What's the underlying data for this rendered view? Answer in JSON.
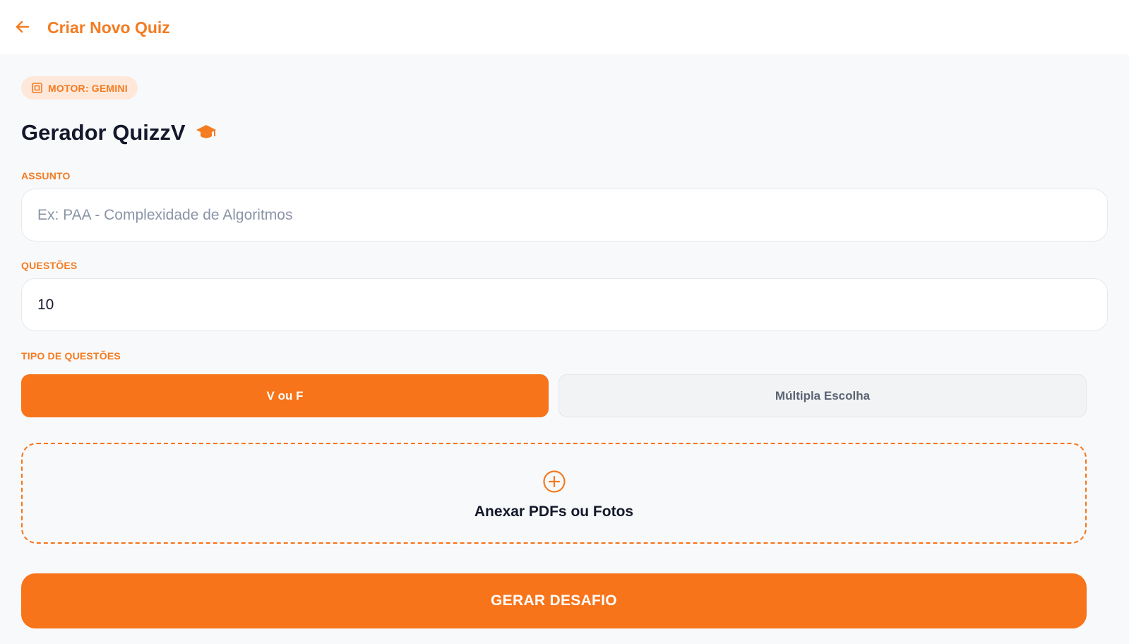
{
  "header": {
    "title": "Criar Novo Quiz",
    "back_icon": "arrow-left-icon"
  },
  "badge": {
    "label": "MOTOR: GEMINI",
    "icon": "chip-icon"
  },
  "heading": {
    "title": "Gerador QuizzV",
    "icon": "graduation-cap-icon"
  },
  "form": {
    "subject": {
      "label": "ASSUNTO",
      "placeholder": "Ex: PAA - Complexidade de Algoritmos",
      "value": ""
    },
    "questions": {
      "label": "QUESTÕES",
      "value": "10"
    },
    "question_type": {
      "label": "TIPO DE QUESTÕES",
      "options": [
        "V ou F",
        "Múltipla Escolha"
      ],
      "selected": "V ou F"
    }
  },
  "upload": {
    "label": "Anexar PDFs ou Fotos",
    "icon": "plus-circle-icon"
  },
  "submit": {
    "label": "GERAR DESAFIO"
  },
  "colors": {
    "accent": "#f7741a",
    "accent_text": "#f47b20",
    "badge_bg": "#fde8da",
    "heading_text": "#14182b",
    "background": "#f8f9fa"
  }
}
